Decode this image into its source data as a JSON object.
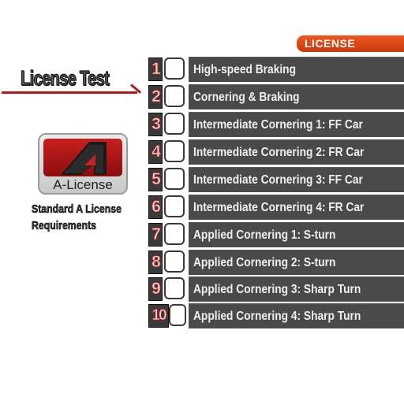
{
  "header": {
    "tab_label": "LICENSE"
  },
  "title": "License Test",
  "license": {
    "name": "A-License",
    "logo_letter": "A",
    "description": "Standard A License Requirements"
  },
  "colors": {
    "accent_orange": "#e0501a",
    "accent_red": "#b41818",
    "row_bg": "#4a4a4a"
  },
  "tests": [
    {
      "number": "1",
      "name": "High-speed Braking",
      "cleared": false
    },
    {
      "number": "2",
      "name": "Cornering & Braking",
      "cleared": false
    },
    {
      "number": "3",
      "name": "Intermediate Cornering 1: FF Car",
      "cleared": false
    },
    {
      "number": "4",
      "name": "Intermediate Cornering 2: FR Car",
      "cleared": false
    },
    {
      "number": "5",
      "name": "Intermediate Cornering 3: FF Car",
      "cleared": false
    },
    {
      "number": "6",
      "name": "Intermediate Cornering 4: FR Car",
      "cleared": false
    },
    {
      "number": "7",
      "name": "Applied Cornering 1: S-turn",
      "cleared": false
    },
    {
      "number": "8",
      "name": "Applied Cornering 2: S-turn",
      "cleared": false
    },
    {
      "number": "9",
      "name": "Applied Cornering 3: Sharp Turn",
      "cleared": false
    },
    {
      "number": "10",
      "name": "Applied Cornering 4: Sharp Turn",
      "cleared": false
    }
  ]
}
